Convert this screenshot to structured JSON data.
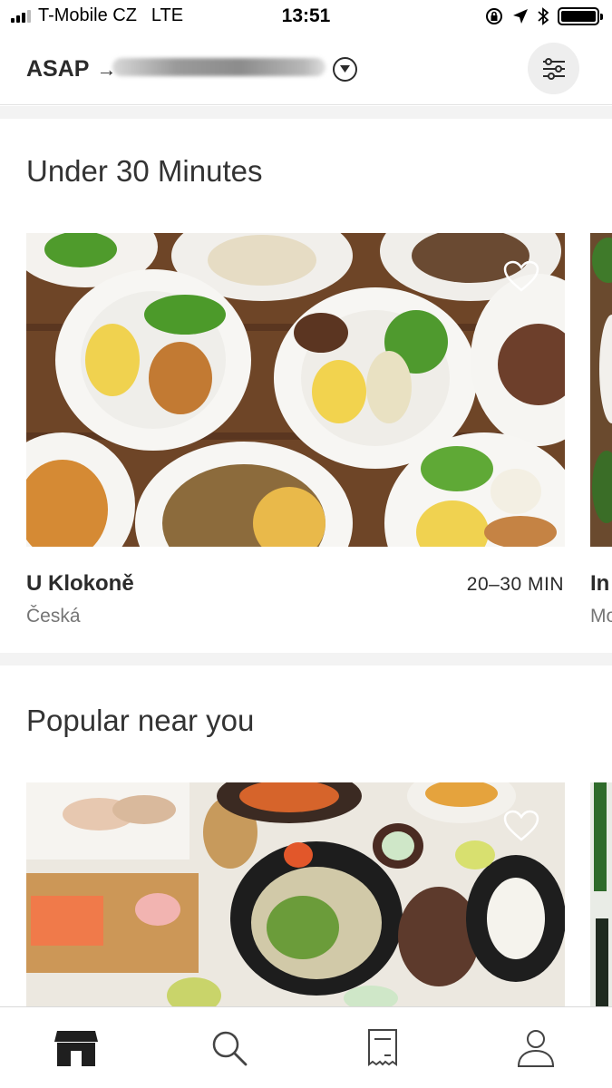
{
  "status_bar": {
    "carrier": "T-Mobile CZ",
    "network": "LTE",
    "time": "13:51"
  },
  "header": {
    "schedule_label": "ASAP",
    "arrow": "→",
    "filter_icon": "sliders-icon",
    "dropdown_icon": "chevron-down-circle-icon"
  },
  "sections": [
    {
      "title": "Under 30 Minutes",
      "restaurant": {
        "name": "U Klokoně",
        "cuisine": "Česká",
        "delivery_time": "20–30 MIN"
      },
      "next_restaurant": {
        "name": "In",
        "cuisine": "Mo"
      }
    },
    {
      "title": "Popular near you"
    }
  ],
  "tab_bar": {
    "tabs": [
      "home-storefront-icon",
      "search-icon",
      "orders-receipt-icon",
      "account-person-icon"
    ],
    "active_tab": "home-storefront-icon"
  }
}
